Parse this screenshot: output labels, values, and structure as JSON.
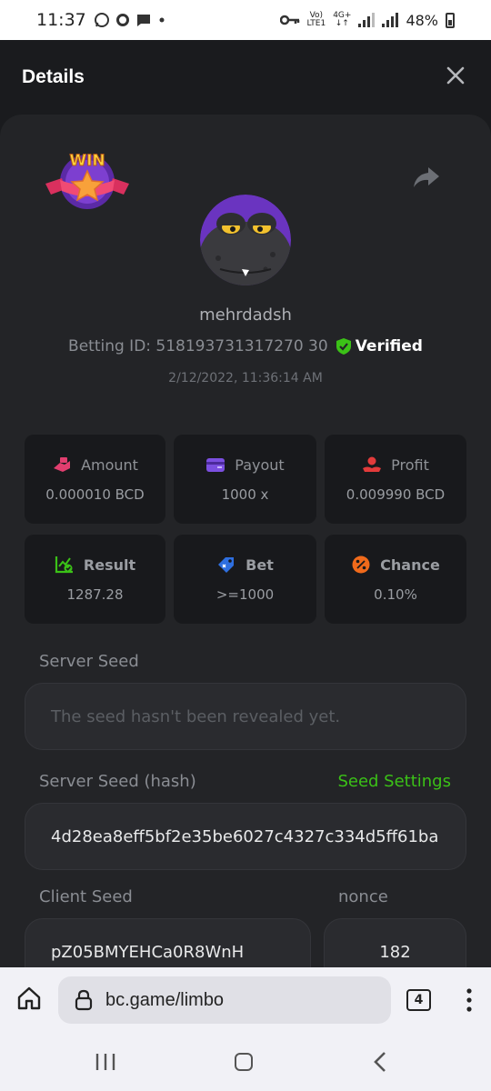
{
  "statusbar": {
    "time": "11:37",
    "network_top": "Vo)",
    "network_bottom": "LTE1",
    "gen_top": "4G+",
    "gen_bottom": "↓↑",
    "battery": "48%"
  },
  "header": {
    "title": "Details"
  },
  "profile": {
    "badge_text": "WIN",
    "username": "mehrdadsh",
    "betting_id": "Betting ID: 518193731317270 30",
    "verified_label": "Verified",
    "datetime": "2/12/2022, 11:36:14 AM"
  },
  "cards": [
    {
      "label": "Amount",
      "value": "0.000010 BCD",
      "icon": "money-hand-icon",
      "color": "#e23e6f"
    },
    {
      "label": "Payout",
      "value": "1000 x",
      "icon": "wallet-icon",
      "color": "#7b4fe0"
    },
    {
      "label": "Profit",
      "value": "0.009990 BCD",
      "icon": "profit-hand-icon",
      "color": "#e23b3b"
    },
    {
      "label": "Result",
      "value": "1287.28",
      "icon": "chart-check-icon",
      "color": "#3bc117"
    },
    {
      "label": "Bet",
      "value": ">=1000",
      "icon": "tag-icon",
      "color": "#2e6fe0"
    },
    {
      "label": "Chance",
      "value": "0.10%",
      "icon": "percent-icon",
      "color": "#f06a1b"
    }
  ],
  "seeds": {
    "server_seed_label": "Server Seed",
    "server_seed_placeholder": "The seed hasn't been revealed yet.",
    "server_hash_label": "Server Seed (hash)",
    "seed_settings_label": "Seed Settings",
    "server_hash_value": "4d28ea8eff5bf2e35be6027c4327c334d5ff61ba",
    "client_seed_label": "Client Seed",
    "nonce_label": "nonce",
    "client_seed_value": "pZ05BMYEHCa0R8WnH",
    "nonce_value": "182"
  },
  "browser": {
    "url": "bc.game/limbo",
    "tab_count": "4"
  },
  "colors": {
    "accent_green": "#3bc117",
    "background": "#1a1b1e",
    "panel": "#232427"
  }
}
